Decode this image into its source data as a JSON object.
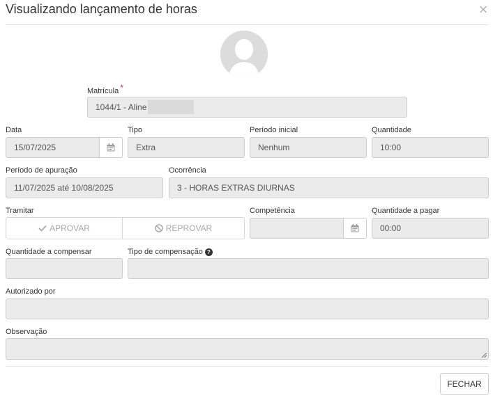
{
  "modal": {
    "title": "Visualizando lançamento de horas",
    "close_label": "×"
  },
  "matricula": {
    "label": "Matrícula",
    "required_mark": "*",
    "value": "1044/1 - Aline"
  },
  "data_field": {
    "label": "Data",
    "value": "15/07/2025"
  },
  "tipo": {
    "label": "Tipo",
    "value": "Extra"
  },
  "periodo_inicial": {
    "label": "Período inicial",
    "value": "Nenhum"
  },
  "quantidade": {
    "label": "Quantidade",
    "value": "10:00"
  },
  "periodo_apuracao": {
    "label": "Período de apuração",
    "value": "11/07/2025 até 10/08/2025"
  },
  "ocorrencia": {
    "label": "Ocorrência",
    "value": "3 - HORAS EXTRAS DIURNAS"
  },
  "tramitar": {
    "label": "Tramitar",
    "approve_label": "APROVAR",
    "reject_label": "REPROVAR"
  },
  "competencia": {
    "label": "Competência",
    "value": ""
  },
  "quantidade_pagar": {
    "label": "Quantidade a pagar",
    "value": "00:00"
  },
  "quantidade_compensar": {
    "label": "Quantidade a compensar",
    "value": ""
  },
  "tipo_compensacao": {
    "label": "Tipo de compensação",
    "help_icon": "?",
    "value": ""
  },
  "autorizado_por": {
    "label": "Autorizado por",
    "value": ""
  },
  "observacao": {
    "label": "Observação",
    "value": ""
  },
  "footer": {
    "close_button_label": "FECHAR"
  },
  "colors": {
    "field_bg": "#ebebeb",
    "field_border": "#cccccc",
    "required": "#d9302c",
    "disabled_text": "#a9a9a9"
  },
  "icons": {
    "close": "close-icon",
    "avatar": "user-avatar-icon",
    "calendar": "calendar-icon",
    "check": "check-icon",
    "ban": "ban-icon",
    "help": "question-circle-icon",
    "resize": "resize-handle-icon"
  }
}
